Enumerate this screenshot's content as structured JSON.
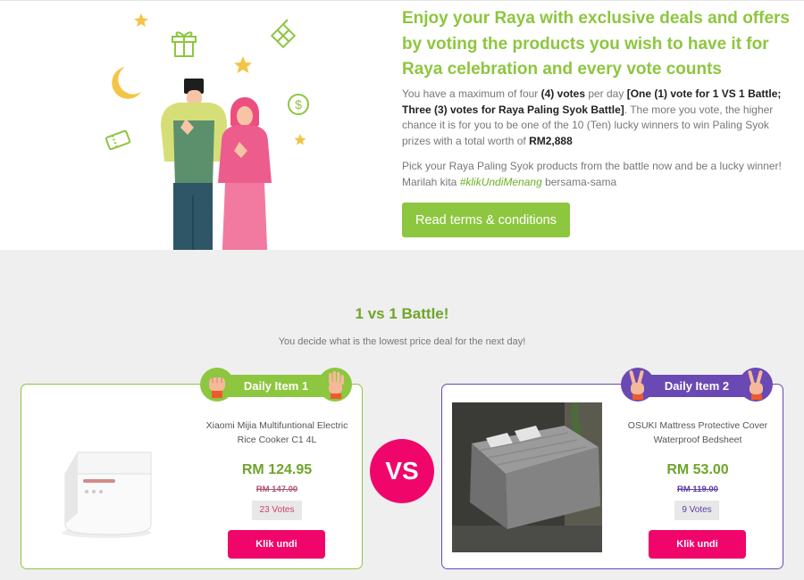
{
  "promo": {
    "headline": "Enjoy your Raya with exclusive deals and offers by voting the products you wish to have it for Raya celebration and every vote counts",
    "rules": {
      "t1": "You have a maximum of four ",
      "b1": "(4) votes",
      "t2": " per day ",
      "b2": "[One (1) vote for 1 VS 1 Battle; Three (3) votes for Raya Paling Syok Battle]",
      "t3": ". The more you vote, the higher chance it is for you to be one of the 10 (Ten) lucky winners to win Paling Syok prizes with a total worth of ",
      "b3": "RM2,888"
    },
    "cta": {
      "t1": "Pick your Raya Paling Syok products from the battle now and be a lucky winner! Marilah kita ",
      "hashtag": "#klikUndiMenang",
      "t2": " bersama-sama"
    },
    "terms_button": "Read terms & conditions"
  },
  "battle": {
    "title": "1 vs 1 Battle!",
    "subtitle": "You decide what is the lowest price deal for the next day!",
    "vs_label": "VS",
    "items": [
      {
        "badge": "Daily Item 1",
        "name": "Xiaomi Mijia Multifuntional Electric Rice Cooker C1 4L",
        "price": "RM 124.95",
        "old_price": "RM 147.00",
        "votes": "23 Votes",
        "button": "Klik undi"
      },
      {
        "badge": "Daily Item 2",
        "name": "OSUKI Mattress Protective Cover Waterproof Bedsheet",
        "price": "RM 53.00",
        "old_price": "RM 119.00",
        "votes": "9 Votes",
        "button": "Klik undi"
      }
    ]
  },
  "colors": {
    "brand_green": "#8dc63f",
    "brand_purple": "#6a49b5",
    "vote_pink": "#f0066b"
  }
}
